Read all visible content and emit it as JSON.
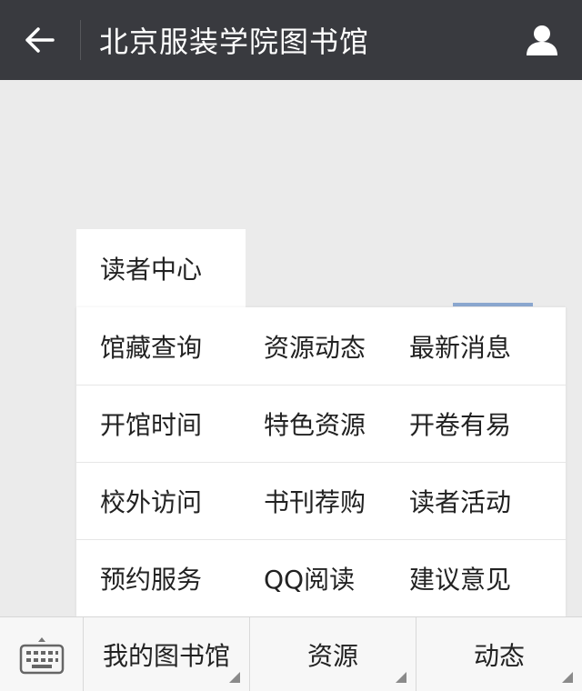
{
  "header": {
    "title": "北京服装学院图书馆",
    "back_icon": "arrow-left-icon",
    "user_icon": "user-icon"
  },
  "menu": {
    "parent_label": "读者中心",
    "rows": [
      [
        "馆藏查询",
        "资源动态",
        "最新消息"
      ],
      [
        "开馆时间",
        "特色资源",
        "开卷有易"
      ],
      [
        "校外访问",
        "书刊荐购",
        "读者活动"
      ],
      [
        "预约服务",
        "QQ阅读",
        "建议意见"
      ]
    ]
  },
  "bottom_bar": {
    "keyboard_icon": "keyboard-icon",
    "tabs": [
      "我的图书馆",
      "资源",
      "动态"
    ]
  },
  "colors": {
    "header_bg": "#393a3f",
    "page_bg": "#ebebeb",
    "accent": "#3b6fb8"
  }
}
